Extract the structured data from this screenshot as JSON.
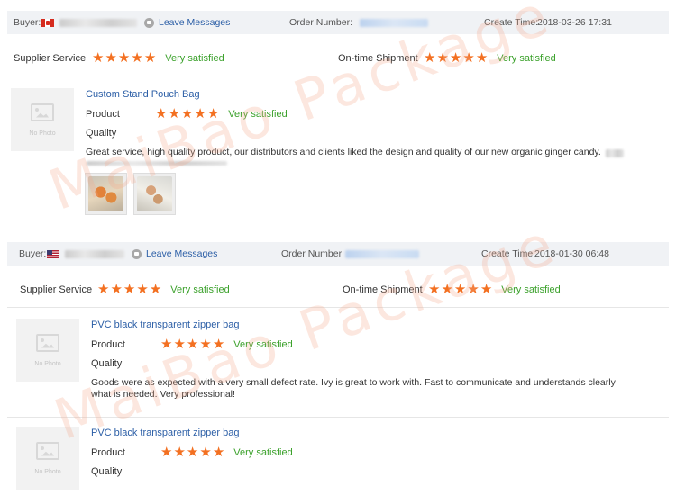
{
  "orders": [
    {
      "buyer_label": "Buyer:",
      "leave_messages": "Leave Messages",
      "order_number_label": "Order Number:",
      "create_time_label": "Create Time:",
      "create_time": "2018-03-26 17:31",
      "supplier_service_label": "Supplier Service",
      "supplier_service_rating": 5,
      "supplier_service_text": "Very satisfied",
      "ontime_label": "On-time Shipment",
      "ontime_rating": 5,
      "ontime_text": "Very satisfied",
      "items": [
        {
          "no_photo": "No Photo",
          "title": "Custom Stand Pouch Bag",
          "product_label": "Product",
          "product_rating": 5,
          "product_text": "Very satisfied",
          "quality_label": "Quality",
          "review": "Great service, high quality product, our distributors and clients liked the design and quality of our new organic ginger candy."
        }
      ]
    },
    {
      "buyer_label": "Buyer:",
      "leave_messages": "Leave Messages",
      "order_number_label": "Order Number",
      "create_time_label": "Create Time:",
      "create_time": "2018-01-30 06:48",
      "supplier_service_label": "Supplier Service",
      "supplier_service_rating": 5,
      "supplier_service_text": "Very satisfied",
      "ontime_label": "On-time Shipment",
      "ontime_rating": 5,
      "ontime_text": "Very satisfied",
      "items": [
        {
          "no_photo": "No Photo",
          "title": "PVC black transparent zipper bag",
          "product_label": "Product",
          "product_rating": 5,
          "product_text": "Very satisfied",
          "quality_label": "Quality",
          "review": "Goods were as expected with a very small defect rate. Ivy is great to work with. Fast to communicate and understands clearly what is needed. Very professional!"
        },
        {
          "no_photo": "No Photo",
          "title": "PVC black transparent zipper bag",
          "product_label": "Product",
          "product_rating": 5,
          "product_text": "Very satisfied",
          "quality_label": "Quality"
        }
      ]
    }
  ],
  "watermark": "MaiBao Package",
  "colors": {
    "star": "#f37021",
    "satisfied": "#3ba12b",
    "link": "#2b5ea6",
    "header_bg": "#f0f2f5"
  },
  "icons": {
    "star": "star-icon",
    "message": "message-icon",
    "no_photo": "image-placeholder-icon"
  }
}
